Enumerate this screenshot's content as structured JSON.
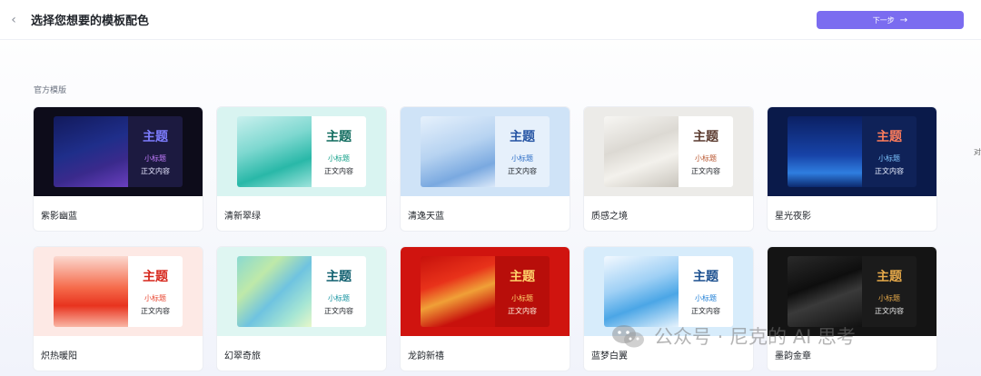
{
  "header": {
    "title": "选择您想要的模板配色",
    "next_label": "下一步",
    "next_arrow": "→"
  },
  "section": {
    "label": "官方模版"
  },
  "side_label": "对",
  "cards": [
    {
      "name": "紫影幽蓝",
      "title": "主题",
      "subtitle": "小标题",
      "body": "正文内容",
      "bg": "#0d0c1a",
      "img": "linear-gradient(160deg,#121a5c 0%,#1f2e8a 45%,#3a2a8c 70%,#6a3fbf 100%)",
      "panel": "#1c1a40",
      "title_color": "#7d7dff",
      "sub_color": "#c27cff",
      "body_color": "#e6e6ff"
    },
    {
      "name": "清新翠绿",
      "title": "主题",
      "subtitle": "小标题",
      "body": "正文内容",
      "bg": "#d9f4f1",
      "img": "linear-gradient(160deg,#c9f0ee 0%,#7ed8d0 40%,#29b8a8 70%,#9ee3dc 100%)",
      "panel": "#ffffff",
      "title_color": "#0f6b5e",
      "sub_color": "#12a089",
      "body_color": "#1f2329"
    },
    {
      "name": "清逸天蓝",
      "title": "主题",
      "subtitle": "小标题",
      "body": "正文内容",
      "bg": "#cfe3f7",
      "img": "linear-gradient(160deg,#e6f1fc 0%,#b7d3f1 45%,#7aa9e0 75%,#dbe9f9 100%)",
      "panel": "#e6f0fb",
      "title_color": "#2453a3",
      "sub_color": "#2e6fc7",
      "body_color": "#1f2329"
    },
    {
      "name": "质感之境",
      "title": "主题",
      "subtitle": "小标题",
      "body": "正文内容",
      "bg": "#ecebe8",
      "img": "linear-gradient(160deg,#f7f6f3 0%,#dcd9d3 40%,#f3f1ec 65%,#c9c5bd 100%)",
      "panel": "#ffffff",
      "title_color": "#5a3a2e",
      "sub_color": "#b8552e",
      "body_color": "#1f2329"
    },
    {
      "name": "星光夜影",
      "title": "主题",
      "subtitle": "小标题",
      "body": "正文内容",
      "bg": "#0a1a4a",
      "img": "linear-gradient(180deg,#0b2063 0%,#1743a8 55%,#2f7ee0 80%,#0c2a6e 100%)",
      "panel": "#0f2258",
      "title_color": "#ff7d5c",
      "sub_color": "#7fc6ff",
      "body_color": "#e8efff"
    },
    {
      "name": "炽热暖阳",
      "title": "主题",
      "subtitle": "小标题",
      "body": "正文内容",
      "bg": "#fde9e5",
      "img": "linear-gradient(180deg,#fbd8cf 0%,#f56a4a 45%,#e8331e 70%,#f9b6a5 100%)",
      "panel": "#ffffff",
      "title_color": "#d6261b",
      "sub_color": "#e8452f",
      "body_color": "#1f2329"
    },
    {
      "name": "幻翠奇旅",
      "title": "主题",
      "subtitle": "小标题",
      "body": "正文内容",
      "bg": "#dff6f2",
      "img": "linear-gradient(135deg,#8ad9d0 0%,#bfe9a9 30%,#6fc3e0 55%,#a7e6d4 80%,#e7f7c9 100%)",
      "panel": "#ffffff",
      "title_color": "#0f5f6f",
      "sub_color": "#1493a0",
      "body_color": "#1f2329"
    },
    {
      "name": "龙韵新禧",
      "title": "主题",
      "subtitle": "小标题",
      "body": "正文内容",
      "bg": "#d0140f",
      "img": "linear-gradient(160deg,#c8110c 0%,#e8321a 35%,#f0a037 55%,#c8110c 80%)",
      "panel": "#b80e0a",
      "title_color": "#ffd36b",
      "sub_color": "#ffd36b",
      "body_color": "#fff3e0"
    },
    {
      "name": "蓝梦白翼",
      "title": "主题",
      "subtitle": "小标题",
      "body": "正文内容",
      "bg": "#d7ecfb",
      "img": "linear-gradient(160deg,#f3f9ff 0%,#9fd0f5 40%,#4ba6e6 65%,#e6f3fd 100%)",
      "panel": "#ffffff",
      "title_color": "#1b4f8f",
      "sub_color": "#1f7fd6",
      "body_color": "#1f2329"
    },
    {
      "name": "墨韵金章",
      "title": "主题",
      "subtitle": "小标题",
      "body": "正文内容",
      "bg": "#141414",
      "img": "linear-gradient(160deg,#2a2a2a 0%,#0e0e0e 40%,#3a3a3a 60%,#111 100%)",
      "panel": "#1b1b1b",
      "title_color": "#e6a94a",
      "sub_color": "#e6a94a",
      "body_color": "#e8e8e8"
    }
  ],
  "watermark": "公众号 · 尼克的 AI 思考"
}
